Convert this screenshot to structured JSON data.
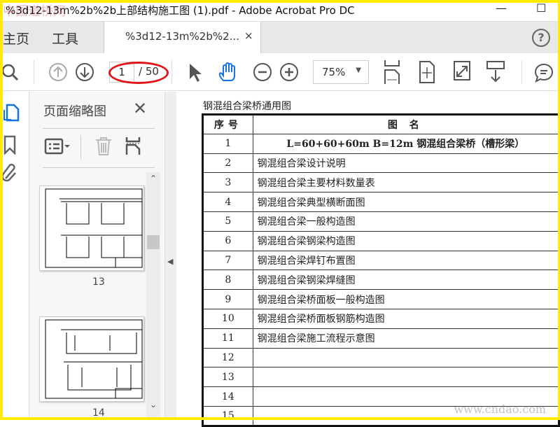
{
  "window": {
    "title": "%3d12-13m%2b%2b上部结构施工图 (1).pdf - Adobe Acrobat Pro DC",
    "watermark_top": "中国道桥网",
    "watermark_bottom": "www.cndao.com",
    "minimize": "—",
    "maximize": "☐"
  },
  "tabs": {
    "home": "主页",
    "tools": "工具",
    "doc_tab": "%3d12-13m%2b%2...",
    "close": "×",
    "help": "?"
  },
  "toolbar": {
    "current_page": "1",
    "total_pages": "/ 50",
    "zoom": "75%"
  },
  "panel": {
    "title": "页面缩略图",
    "close": "✕",
    "thumbnails": [
      {
        "page": "13"
      },
      {
        "page": "14"
      }
    ]
  },
  "document": {
    "title": "钢混组合梁桥通用图",
    "headers": [
      "序号",
      "图 名"
    ],
    "rows": [
      [
        "1",
        "L=60+60+60m B=12m 钢混组合梁桥（槽形梁）"
      ],
      [
        "2",
        "钢混组合梁设计说明"
      ],
      [
        "3",
        "钢混组合梁主要材料数量表"
      ],
      [
        "4",
        "钢混组合梁典型横断面图"
      ],
      [
        "5",
        "钢混组合梁一般构造图"
      ],
      [
        "6",
        "钢混组合梁钢梁构造图"
      ],
      [
        "7",
        "钢混组合梁焊钉布置图"
      ],
      [
        "8",
        "钢混组合梁钢梁焊缝图"
      ],
      [
        "9",
        "钢混组合梁桥面板一般构造图"
      ],
      [
        "10",
        "钢混组合梁桥面板钢筋构造图"
      ],
      [
        "11",
        "钢混组合梁施工流程示意图"
      ],
      [
        "12",
        ""
      ],
      [
        "13",
        ""
      ],
      [
        "14",
        ""
      ],
      [
        "15",
        ""
      ]
    ]
  }
}
